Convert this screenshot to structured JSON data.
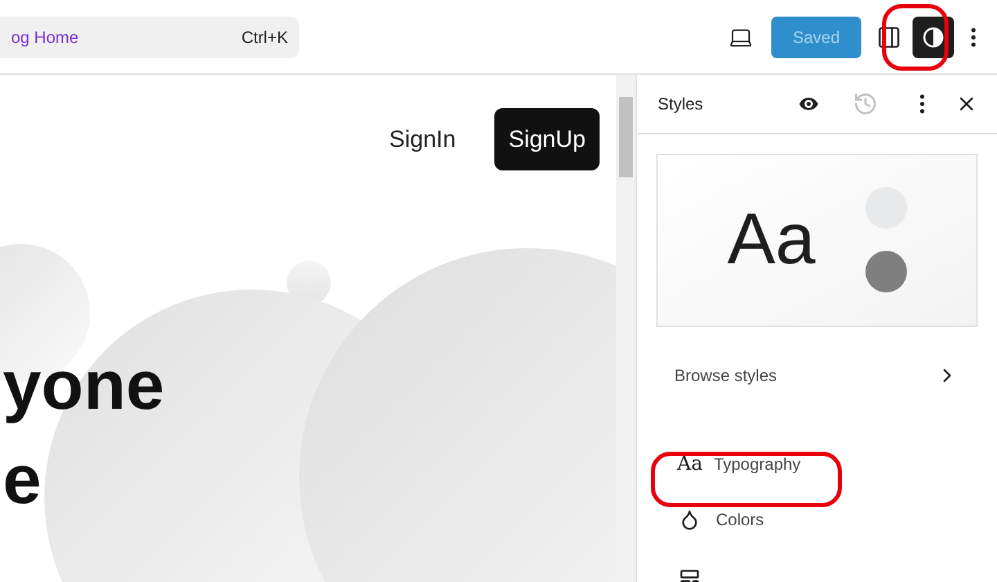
{
  "top_bar": {
    "search": {
      "value": "og Home",
      "shortcut": "Ctrl+K"
    },
    "save_button": {
      "label": "Saved",
      "disabled": true
    },
    "styles_toggle": {
      "pressed": true
    }
  },
  "canvas": {
    "nav": [
      "SignIn",
      "SignUp"
    ],
    "headline": [
      "yone",
      "e"
    ]
  },
  "styles_panel": {
    "title": "Styles",
    "preview_text": "Aa",
    "browse": "Browse styles",
    "items": [
      {
        "kind": "typography",
        "icon_text": "Aa",
        "label": "Typography"
      },
      {
        "kind": "colors",
        "label": "Colors"
      },
      {
        "kind": "layout"
      }
    ]
  }
}
